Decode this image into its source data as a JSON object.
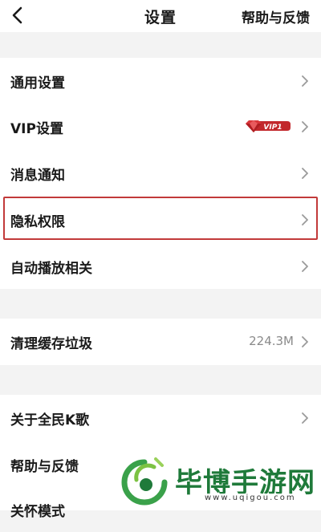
{
  "header": {
    "title": "设置",
    "help_label": "帮助与反馈"
  },
  "section1": {
    "items": [
      {
        "label": "通用设置"
      },
      {
        "label": "VIP设置",
        "badge": "VIP1"
      },
      {
        "label": "消息通知"
      },
      {
        "label": "隐私权限",
        "highlighted": true
      },
      {
        "label": "自动播放相关"
      }
    ]
  },
  "section2": {
    "items": [
      {
        "label": "清理缓存垃圾",
        "value": "224.3M"
      }
    ]
  },
  "section3": {
    "items": [
      {
        "label": "关于全民K歌"
      },
      {
        "label": "帮助与反馈"
      },
      {
        "label": "关怀模式"
      }
    ]
  },
  "watermark": {
    "title": "毕博手游网",
    "url": "www.uqigou.com"
  },
  "colors": {
    "background": "#f3f3f3",
    "highlight_border": "#c23a3a",
    "vip_badge": "#c2282c",
    "watermark_green": "#1f7a3a"
  },
  "icons": [
    "back-arrow-icon",
    "chevron-right-icon",
    "vip-diamond-icon"
  ]
}
